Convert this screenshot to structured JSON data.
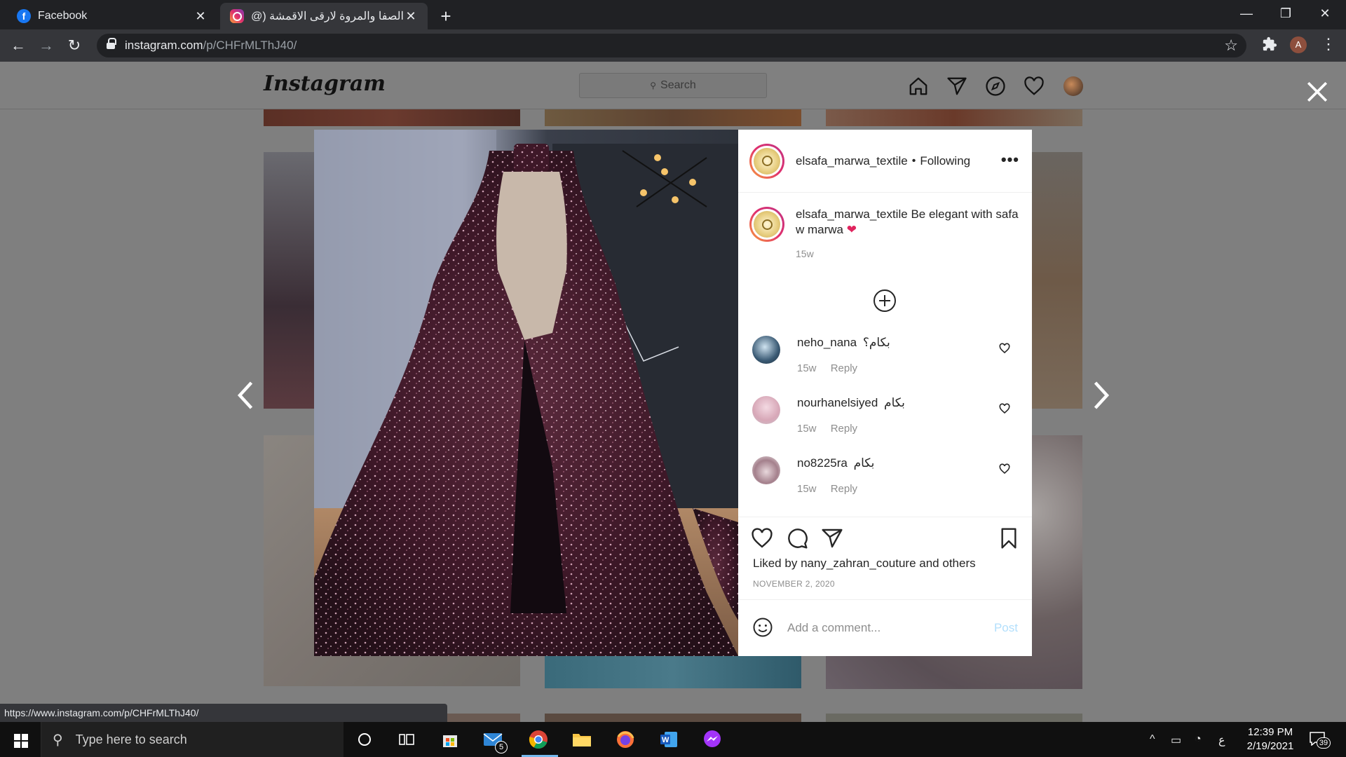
{
  "browser": {
    "tabs": [
      {
        "title": "Facebook",
        "favicon": "facebook-icon",
        "active": false
      },
      {
        "title": "الصفا والمروة لارقى الاقمشة (@ile",
        "favicon": "instagram-icon",
        "active": true
      }
    ],
    "url_domain": "instagram.com",
    "url_path": "/p/CHFrMLThJ40/",
    "profile_initial": "A",
    "status_url": "https://www.instagram.com/p/CHFrMLThJ40/"
  },
  "instagram": {
    "logo": "Instagram",
    "search_placeholder": "Search"
  },
  "post": {
    "username": "elsafa_marwa_textile",
    "following": "Following",
    "caption_user": "elsafa_marwa_textile",
    "caption_text": "Be elegant with safa w marwa",
    "caption_emoji": "❤",
    "caption_time": "15w",
    "comments": [
      {
        "user": "neho_nana",
        "text": "بكام؟",
        "time": "15w",
        "reply": "Reply"
      },
      {
        "user": "nourhanelsiyed",
        "text": "بكام",
        "time": "15w",
        "reply": "Reply"
      },
      {
        "user": "no8225ra",
        "text": "بكام",
        "time": "15w",
        "reply": "Reply"
      }
    ],
    "liked_by_prefix": "Liked by",
    "liked_by_user": "nany_zahran_couture",
    "liked_by_and": "and",
    "liked_by_others": "others",
    "date": "NOVEMBER 2, 2020",
    "comment_placeholder": "Add a comment...",
    "post_label": "Post"
  },
  "taskbar": {
    "search_placeholder": "Type here to search",
    "mail_badge": "5",
    "ime": "ع",
    "time": "12:39 PM",
    "date": "2/19/2021",
    "notification_count": "39"
  },
  "colors": {
    "instagram_ring_start": "#f9a23a",
    "instagram_ring_end": "#c13584",
    "post_button": "#b2dffc",
    "heart_red": "#e0245e"
  }
}
